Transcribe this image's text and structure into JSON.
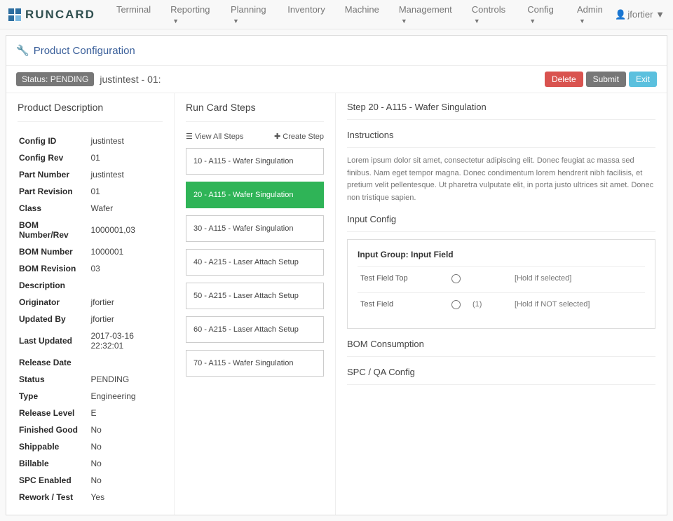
{
  "brand": "RUNCARD",
  "nav": [
    "Terminal",
    "Reporting",
    "Planning",
    "Inventory",
    "Machine",
    "Management",
    "Controls",
    "Config",
    "Admin"
  ],
  "nav_dropdown": [
    false,
    true,
    true,
    false,
    false,
    true,
    true,
    true,
    true
  ],
  "user": "jfortier",
  "page_title": "Product Configuration",
  "status_label": "Status: PENDING",
  "sub_title": "justintest - 01:",
  "buttons": {
    "delete": "Delete",
    "submit": "Submit",
    "exit": "Exit"
  },
  "left_title": "Product Description",
  "desc": [
    {
      "label": "Config ID",
      "value": "justintest"
    },
    {
      "label": "Config Rev",
      "value": "01"
    },
    {
      "label": "Part Number",
      "value": "justintest"
    },
    {
      "label": "Part Revision",
      "value": "01"
    },
    {
      "label": "Class",
      "value": "Wafer"
    },
    {
      "label": "BOM Number/Rev",
      "value": "1000001,03"
    },
    {
      "label": "BOM Number",
      "value": "1000001"
    },
    {
      "label": "BOM Revision",
      "value": "03"
    },
    {
      "label": "Description",
      "value": ""
    },
    {
      "label": "Originator",
      "value": "jfortier"
    },
    {
      "label": "Updated By",
      "value": "jfortier"
    },
    {
      "label": "Last Updated",
      "value": "2017-03-16 22:32:01"
    },
    {
      "label": "Release Date",
      "value": ""
    },
    {
      "label": "Status",
      "value": "PENDING"
    },
    {
      "label": "Type",
      "value": "Engineering"
    },
    {
      "label": "Release Level",
      "value": "E"
    },
    {
      "label": "Finished Good",
      "value": "No"
    },
    {
      "label": "Shippable",
      "value": "No"
    },
    {
      "label": "Billable",
      "value": "No"
    },
    {
      "label": "SPC Enabled",
      "value": "No"
    },
    {
      "label": "Rework / Test",
      "value": "Yes"
    }
  ],
  "mid_title": "Run Card Steps",
  "view_all": "View All Steps",
  "create_step": "Create Step",
  "steps": [
    {
      "label": "10 - A115 - Wafer Singulation",
      "active": false
    },
    {
      "label": "20 - A115 - Wafer Singulation",
      "active": true
    },
    {
      "label": "30 - A115 - Wafer Singulation",
      "active": false
    },
    {
      "label": "40 - A215 - Laser Attach Setup",
      "active": false
    },
    {
      "label": "50 - A215 - Laser Attach Setup",
      "active": false
    },
    {
      "label": "60 - A215 - Laser Attach Setup",
      "active": false
    },
    {
      "label": "70 - A115 - Wafer Singulation",
      "active": false
    }
  ],
  "right_title": "Step 20 - A115 - Wafer Singulation",
  "sections": {
    "instructions": "Instructions",
    "input_config": "Input Config",
    "bom": "BOM Consumption",
    "spc": "SPC / QA Config"
  },
  "instructions_text": "Lorem ipsum dolor sit amet, consectetur adipiscing elit. Donec feugiat ac massa sed finibus. Nam eget tempor magna. Donec condimentum lorem hendrerit nibh facilisis, et pretium velit pellentesque. Ut pharetra vulputate elit, in porta justo ultrices sit amet. Donec non tristique sapien.",
  "input_group_label": "Input Group: Input Field",
  "input_rows": [
    {
      "name": "Test Field Top",
      "note": "",
      "hold": "[Hold if selected]"
    },
    {
      "name": "Test Field",
      "note": "(1)",
      "hold": "[Hold if NOT selected]"
    }
  ]
}
